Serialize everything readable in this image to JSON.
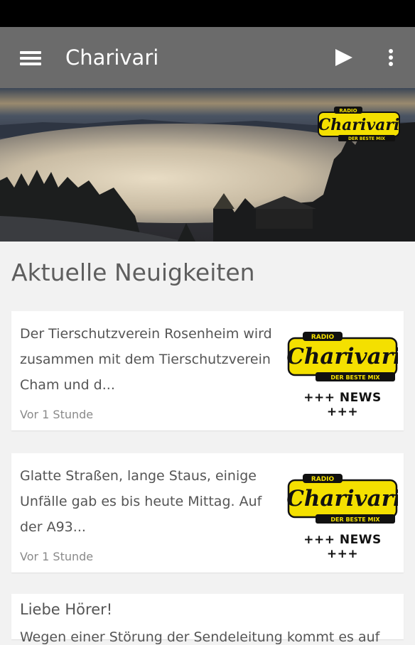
{
  "toolbar": {
    "title": "Charivari",
    "menu_icon": "hamburger-menu-icon",
    "play_icon": "play-icon",
    "more_icon": "more-vert-icon"
  },
  "hero": {
    "logo": {
      "top": "RADIO",
      "main": "Charivari",
      "bottom": "DER BESTE MIX"
    }
  },
  "section": {
    "heading": "Aktuelle Neuigkeiten"
  },
  "news": [
    {
      "text": "Der Tierschutzverein Rosenheim wird zusammen mit dem Tierschutzverein Cham und d...",
      "time": "Vor 1 Stunde",
      "logo_top": "RADIO",
      "logo_main": "Charivari",
      "logo_bottom": "DER BESTE MIX",
      "badge": "+++ NEWS +++"
    },
    {
      "text": "Glatte Straßen, lange Staus, einige Unfälle gab es bis heute Mittag. Auf der A93...",
      "time": "Vor 1 Stunde",
      "logo_top": "RADIO",
      "logo_main": "Charivari",
      "logo_bottom": "DER BESTE MIX",
      "badge": "+++ NEWS +++"
    },
    {
      "title": "Liebe Hörer!",
      "text": "Wegen einer Störung der Sendeleitung kommt es auf"
    }
  ],
  "colors": {
    "toolbar": "#6b6b6b",
    "logo_yellow": "#f4e000",
    "background": "#f2f2f2"
  }
}
